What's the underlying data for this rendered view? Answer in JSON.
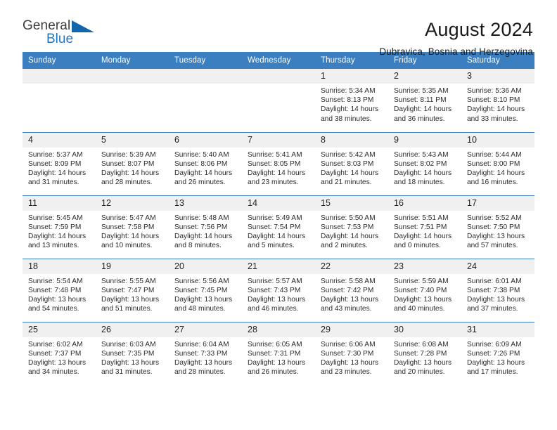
{
  "logo": {
    "word_one": "General",
    "word_two": "Blue",
    "triangle": "triangle-mark",
    "brand_blue": "#1065ab",
    "text_blue": "#1f77c4"
  },
  "header": {
    "title": "August 2024",
    "subtitle": "Dubravica, Bosnia and Herzegovina"
  },
  "calendar": {
    "header_color": "#3b7fc0",
    "weekdays": [
      "Sunday",
      "Monday",
      "Tuesday",
      "Wednesday",
      "Thursday",
      "Friday",
      "Saturday"
    ],
    "weeks": [
      [
        {
          "day": "",
          "blank": true,
          "sunrise": "",
          "sunset": "",
          "daylight_1": "",
          "daylight_2": ""
        },
        {
          "day": "",
          "blank": true,
          "sunrise": "",
          "sunset": "",
          "daylight_1": "",
          "daylight_2": ""
        },
        {
          "day": "",
          "blank": true,
          "sunrise": "",
          "sunset": "",
          "daylight_1": "",
          "daylight_2": ""
        },
        {
          "day": "",
          "blank": true,
          "sunrise": "",
          "sunset": "",
          "daylight_1": "",
          "daylight_2": ""
        },
        {
          "day": "1",
          "blank": false,
          "sunrise": "Sunrise: 5:34 AM",
          "sunset": "Sunset: 8:13 PM",
          "daylight_1": "Daylight: 14 hours",
          "daylight_2": "and 38 minutes."
        },
        {
          "day": "2",
          "blank": false,
          "sunrise": "Sunrise: 5:35 AM",
          "sunset": "Sunset: 8:11 PM",
          "daylight_1": "Daylight: 14 hours",
          "daylight_2": "and 36 minutes."
        },
        {
          "day": "3",
          "blank": false,
          "sunrise": "Sunrise: 5:36 AM",
          "sunset": "Sunset: 8:10 PM",
          "daylight_1": "Daylight: 14 hours",
          "daylight_2": "and 33 minutes."
        }
      ],
      [
        {
          "day": "4",
          "blank": false,
          "sunrise": "Sunrise: 5:37 AM",
          "sunset": "Sunset: 8:09 PM",
          "daylight_1": "Daylight: 14 hours",
          "daylight_2": "and 31 minutes."
        },
        {
          "day": "5",
          "blank": false,
          "sunrise": "Sunrise: 5:39 AM",
          "sunset": "Sunset: 8:07 PM",
          "daylight_1": "Daylight: 14 hours",
          "daylight_2": "and 28 minutes."
        },
        {
          "day": "6",
          "blank": false,
          "sunrise": "Sunrise: 5:40 AM",
          "sunset": "Sunset: 8:06 PM",
          "daylight_1": "Daylight: 14 hours",
          "daylight_2": "and 26 minutes."
        },
        {
          "day": "7",
          "blank": false,
          "sunrise": "Sunrise: 5:41 AM",
          "sunset": "Sunset: 8:05 PM",
          "daylight_1": "Daylight: 14 hours",
          "daylight_2": "and 23 minutes."
        },
        {
          "day": "8",
          "blank": false,
          "sunrise": "Sunrise: 5:42 AM",
          "sunset": "Sunset: 8:03 PM",
          "daylight_1": "Daylight: 14 hours",
          "daylight_2": "and 21 minutes."
        },
        {
          "day": "9",
          "blank": false,
          "sunrise": "Sunrise: 5:43 AM",
          "sunset": "Sunset: 8:02 PM",
          "daylight_1": "Daylight: 14 hours",
          "daylight_2": "and 18 minutes."
        },
        {
          "day": "10",
          "blank": false,
          "sunrise": "Sunrise: 5:44 AM",
          "sunset": "Sunset: 8:00 PM",
          "daylight_1": "Daylight: 14 hours",
          "daylight_2": "and 16 minutes."
        }
      ],
      [
        {
          "day": "11",
          "blank": false,
          "sunrise": "Sunrise: 5:45 AM",
          "sunset": "Sunset: 7:59 PM",
          "daylight_1": "Daylight: 14 hours",
          "daylight_2": "and 13 minutes."
        },
        {
          "day": "12",
          "blank": false,
          "sunrise": "Sunrise: 5:47 AM",
          "sunset": "Sunset: 7:58 PM",
          "daylight_1": "Daylight: 14 hours",
          "daylight_2": "and 10 minutes."
        },
        {
          "day": "13",
          "blank": false,
          "sunrise": "Sunrise: 5:48 AM",
          "sunset": "Sunset: 7:56 PM",
          "daylight_1": "Daylight: 14 hours",
          "daylight_2": "and 8 minutes."
        },
        {
          "day": "14",
          "blank": false,
          "sunrise": "Sunrise: 5:49 AM",
          "sunset": "Sunset: 7:54 PM",
          "daylight_1": "Daylight: 14 hours",
          "daylight_2": "and 5 minutes."
        },
        {
          "day": "15",
          "blank": false,
          "sunrise": "Sunrise: 5:50 AM",
          "sunset": "Sunset: 7:53 PM",
          "daylight_1": "Daylight: 14 hours",
          "daylight_2": "and 2 minutes."
        },
        {
          "day": "16",
          "blank": false,
          "sunrise": "Sunrise: 5:51 AM",
          "sunset": "Sunset: 7:51 PM",
          "daylight_1": "Daylight: 14 hours",
          "daylight_2": "and 0 minutes."
        },
        {
          "day": "17",
          "blank": false,
          "sunrise": "Sunrise: 5:52 AM",
          "sunset": "Sunset: 7:50 PM",
          "daylight_1": "Daylight: 13 hours",
          "daylight_2": "and 57 minutes."
        }
      ],
      [
        {
          "day": "18",
          "blank": false,
          "sunrise": "Sunrise: 5:54 AM",
          "sunset": "Sunset: 7:48 PM",
          "daylight_1": "Daylight: 13 hours",
          "daylight_2": "and 54 minutes."
        },
        {
          "day": "19",
          "blank": false,
          "sunrise": "Sunrise: 5:55 AM",
          "sunset": "Sunset: 7:47 PM",
          "daylight_1": "Daylight: 13 hours",
          "daylight_2": "and 51 minutes."
        },
        {
          "day": "20",
          "blank": false,
          "sunrise": "Sunrise: 5:56 AM",
          "sunset": "Sunset: 7:45 PM",
          "daylight_1": "Daylight: 13 hours",
          "daylight_2": "and 48 minutes."
        },
        {
          "day": "21",
          "blank": false,
          "sunrise": "Sunrise: 5:57 AM",
          "sunset": "Sunset: 7:43 PM",
          "daylight_1": "Daylight: 13 hours",
          "daylight_2": "and 46 minutes."
        },
        {
          "day": "22",
          "blank": false,
          "sunrise": "Sunrise: 5:58 AM",
          "sunset": "Sunset: 7:42 PM",
          "daylight_1": "Daylight: 13 hours",
          "daylight_2": "and 43 minutes."
        },
        {
          "day": "23",
          "blank": false,
          "sunrise": "Sunrise: 5:59 AM",
          "sunset": "Sunset: 7:40 PM",
          "daylight_1": "Daylight: 13 hours",
          "daylight_2": "and 40 minutes."
        },
        {
          "day": "24",
          "blank": false,
          "sunrise": "Sunrise: 6:01 AM",
          "sunset": "Sunset: 7:38 PM",
          "daylight_1": "Daylight: 13 hours",
          "daylight_2": "and 37 minutes."
        }
      ],
      [
        {
          "day": "25",
          "blank": false,
          "sunrise": "Sunrise: 6:02 AM",
          "sunset": "Sunset: 7:37 PM",
          "daylight_1": "Daylight: 13 hours",
          "daylight_2": "and 34 minutes."
        },
        {
          "day": "26",
          "blank": false,
          "sunrise": "Sunrise: 6:03 AM",
          "sunset": "Sunset: 7:35 PM",
          "daylight_1": "Daylight: 13 hours",
          "daylight_2": "and 31 minutes."
        },
        {
          "day": "27",
          "blank": false,
          "sunrise": "Sunrise: 6:04 AM",
          "sunset": "Sunset: 7:33 PM",
          "daylight_1": "Daylight: 13 hours",
          "daylight_2": "and 28 minutes."
        },
        {
          "day": "28",
          "blank": false,
          "sunrise": "Sunrise: 6:05 AM",
          "sunset": "Sunset: 7:31 PM",
          "daylight_1": "Daylight: 13 hours",
          "daylight_2": "and 26 minutes."
        },
        {
          "day": "29",
          "blank": false,
          "sunrise": "Sunrise: 6:06 AM",
          "sunset": "Sunset: 7:30 PM",
          "daylight_1": "Daylight: 13 hours",
          "daylight_2": "and 23 minutes."
        },
        {
          "day": "30",
          "blank": false,
          "sunrise": "Sunrise: 6:08 AM",
          "sunset": "Sunset: 7:28 PM",
          "daylight_1": "Daylight: 13 hours",
          "daylight_2": "and 20 minutes."
        },
        {
          "day": "31",
          "blank": false,
          "sunrise": "Sunrise: 6:09 AM",
          "sunset": "Sunset: 7:26 PM",
          "daylight_1": "Daylight: 13 hours",
          "daylight_2": "and 17 minutes."
        }
      ]
    ]
  }
}
